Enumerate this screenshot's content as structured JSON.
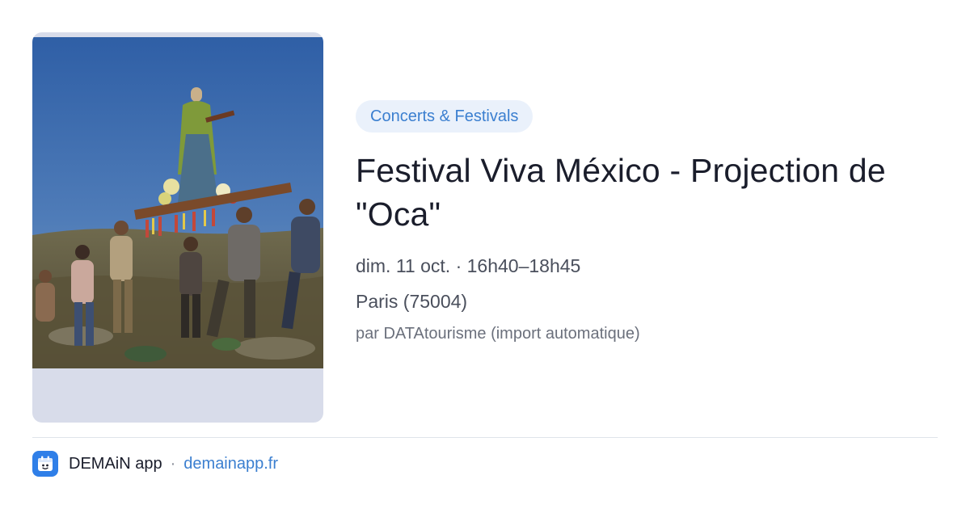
{
  "event": {
    "category": "Concerts & Festivals",
    "title": "Festival Viva México - Projection de \"Oca\"",
    "date_time": "dim. 11 oct. · 16h40–18h45",
    "location": "Paris (75004)",
    "source": "par DATAtourisme (import automatique)"
  },
  "footer": {
    "app_name": "DEMAiN app",
    "separator": "·",
    "domain": "demainapp.fr",
    "app_icon": "calendar-icon"
  },
  "colors": {
    "accent": "#3b7fd0",
    "pill_bg": "#eaf1fb",
    "app_icon_bg": "#2f7fe8",
    "image_placeholder": "#d8dcea"
  }
}
